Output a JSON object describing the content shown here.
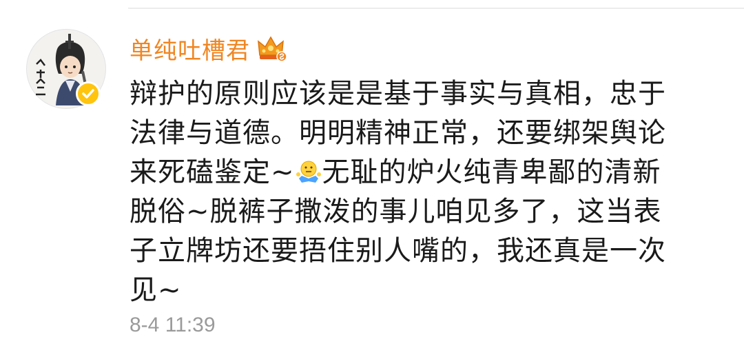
{
  "comment": {
    "username": "单纯吐槽君",
    "avatar_text": "人剑合一",
    "badge_icon": "crown-vip-icon",
    "verified_icon": "verified-check-icon",
    "body_lines": [
      "辩护的原则应该是是基于事实与真相，忠于",
      "法律与道德。明明精神正常，还要绑架舆论",
      "来死磕鉴定~",
      "无耻的炉火纯青卑鄙的清新",
      "脱俗~脱裤子撒泼的事儿咱见多了，这当表",
      "子立牌坊还要捂住别人嘴的，我还真是一次",
      "见~"
    ],
    "emoji": "shrug-emoji",
    "timestamp": "8-4 11:39"
  },
  "colors": {
    "username": "#f08622",
    "body_text": "#1a1a1a",
    "timestamp": "#9a9a9a",
    "verified_badge": "#ffc40e"
  }
}
